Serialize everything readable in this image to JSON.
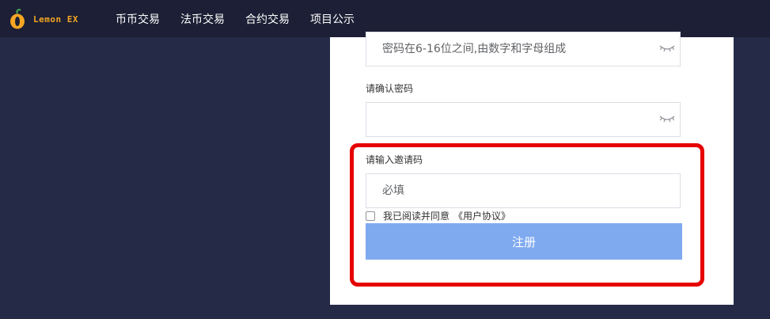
{
  "header": {
    "logo_text": "Lemon EX",
    "nav": [
      "币币交易",
      "法币交易",
      "合约交易",
      "项目公示"
    ]
  },
  "form": {
    "password_placeholder": "密码在6-16位之间,由数字和字母组成",
    "confirm_label": "请确认密码",
    "confirm_value": "",
    "invite_label": "请输入邀请码",
    "invite_placeholder": "必填",
    "agree_text": "我已阅读并同意",
    "agreement_link": "《用户协议》",
    "register_button": "注册"
  },
  "colors": {
    "page_bg": "#252a47",
    "topbar_bg": "#1c1f35",
    "brand": "#f5a623",
    "button": "#7faaf0",
    "highlight": "#e60000"
  },
  "icons": {
    "password_toggle": "eye-closed-icon"
  }
}
